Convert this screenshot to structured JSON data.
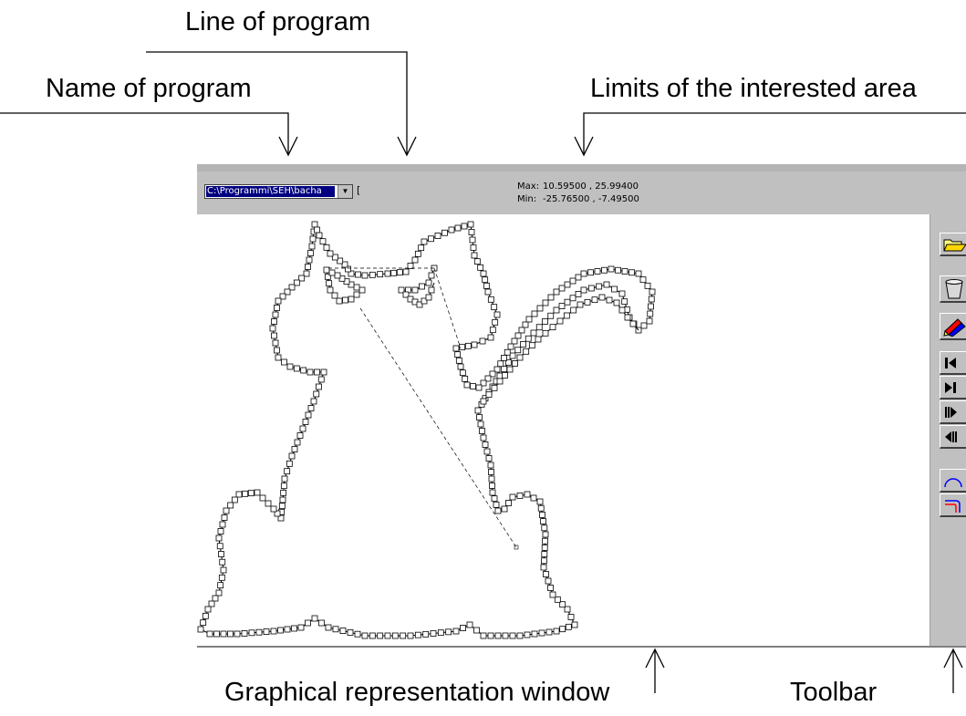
{
  "annotations": {
    "line_of_program": "Line of program",
    "name_of_program": "Name of program",
    "limits_area": "Limits of the interested area",
    "graphical_window": "Graphical representation window",
    "toolbar": "Toolbar"
  },
  "infobar": {
    "program_name": "C:\\Programmi\\SEH\\bacha",
    "program_line": "[",
    "max_label": "Max:",
    "max_value": "10.59500 , 25.99400",
    "min_label": "Min:",
    "min_value": "-25.76500 , -7.49500"
  },
  "toolbar": {
    "buttons": [
      {
        "name": "open-file",
        "icon": "folder-icon"
      },
      {
        "name": "clear",
        "icon": "trash-icon"
      },
      {
        "name": "draw",
        "icon": "pencils-icon"
      },
      {
        "name": "go-to-start",
        "icon": "skip-start-icon"
      },
      {
        "name": "step-forward-pause",
        "icon": "play-pause-icon"
      },
      {
        "name": "fast-forward",
        "icon": "forward-icon"
      },
      {
        "name": "step-back",
        "icon": "back-icon"
      },
      {
        "name": "arc-mode",
        "icon": "arc-icon"
      },
      {
        "name": "corner-mode",
        "icon": "corner-icon"
      }
    ]
  },
  "colors": {
    "window_bg": "#c0c0c0",
    "selection": "#000080",
    "arc_blue": "#0000ff",
    "corner_red": "#ff0000"
  }
}
